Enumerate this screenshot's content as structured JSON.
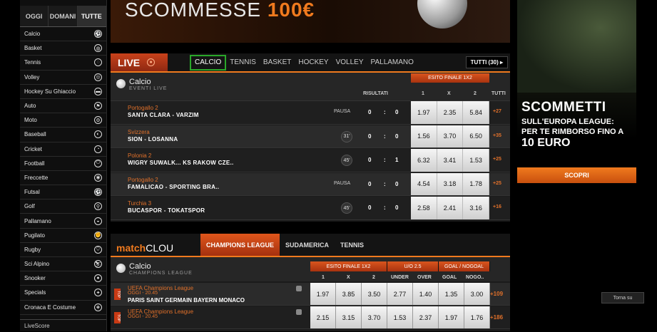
{
  "sidebar": {
    "tabs": [
      {
        "label": "OGGI"
      },
      {
        "label": "DOMANI"
      },
      {
        "label": "TUTTE"
      }
    ],
    "items": [
      {
        "label": "Calcio",
        "icon": "soccer-icon",
        "glyph": "⚽"
      },
      {
        "label": "Basket",
        "icon": "basketball-icon",
        "glyph": "◍"
      },
      {
        "label": "Tennis",
        "icon": "tennis-icon",
        "glyph": "◌"
      },
      {
        "label": "Volley",
        "icon": "volleyball-icon",
        "glyph": "◎"
      },
      {
        "label": "Hockey Su Ghiaccio",
        "icon": "hockey-icon",
        "glyph": "▬"
      },
      {
        "label": "Auto",
        "icon": "auto-icon",
        "glyph": "⚑"
      },
      {
        "label": "Moto",
        "icon": "moto-icon",
        "glyph": "⚙"
      },
      {
        "label": "Baseball",
        "icon": "baseball-icon",
        "glyph": "◐"
      },
      {
        "label": "Cricket",
        "icon": "cricket-icon",
        "glyph": "◔"
      },
      {
        "label": "Football",
        "icon": "football-icon",
        "glyph": "⬭"
      },
      {
        "label": "Freccette",
        "icon": "darts-icon",
        "glyph": "◉"
      },
      {
        "label": "Futsal",
        "icon": "futsal-icon",
        "glyph": "⚽"
      },
      {
        "label": "Golf",
        "icon": "golf-icon",
        "glyph": "⚲"
      },
      {
        "label": "Pallamano",
        "icon": "handball-icon",
        "glyph": "◒"
      },
      {
        "label": "Pugilato",
        "icon": "boxing-icon",
        "glyph": "✊"
      },
      {
        "label": "Rugby",
        "icon": "rugby-icon",
        "glyph": "⬯"
      },
      {
        "label": "Sci Alpino",
        "icon": "ski-icon",
        "glyph": "⛷"
      },
      {
        "label": "Snooker",
        "icon": "snooker-icon",
        "glyph": "●"
      },
      {
        "label": "Specials",
        "icon": "specials-icon",
        "glyph": "✦"
      },
      {
        "label": "Cronaca E Costume",
        "icon": "news-icon",
        "glyph": "◈"
      }
    ],
    "livescore_label": "LiveScore"
  },
  "top_banner": {
    "text": "SCOMMESSE",
    "amount": "100€"
  },
  "live": {
    "label": "LIVE",
    "tabs": [
      "CALCIO",
      "TENNIS",
      "BASKET",
      "HOCKEY",
      "VOLLEY",
      "PALLAMANO"
    ],
    "tutti_button": "TUTTI (30)",
    "sport_title": "Calcio",
    "sport_subtitle": "EVENTI LIVE",
    "col_risultati": "RISULTATI",
    "col_esito": "ESITO FINALE 1X2",
    "col_1": "1",
    "col_x": "X",
    "col_2": "2",
    "col_tutti": "TUTTI",
    "rows": [
      {
        "league": "Portogallo 2",
        "match": "SANTA CLARA - VARZIM",
        "status": "PAUSA",
        "minute": "",
        "home": "0",
        "sep": ":",
        "away": "0",
        "o1": "1.97",
        "ox": "2.35",
        "o2": "5.84",
        "more": "+27"
      },
      {
        "league": "Svizzera",
        "match": "SION - LOSANNA",
        "status": "",
        "minute": "31'",
        "home": "0",
        "sep": ":",
        "away": "0",
        "o1": "1.56",
        "ox": "3.70",
        "o2": "6.50",
        "more": "+35"
      },
      {
        "league": "Polonia 2",
        "match": "WIGRY SUWALK... KS RAKOW CZE..",
        "status": "",
        "minute": "45'",
        "home": "0",
        "sep": ":",
        "away": "1",
        "o1": "6.32",
        "ox": "3.41",
        "o2": "1.53",
        "more": "+25"
      },
      {
        "league": "Portogallo 2",
        "match": "FAMALICAO - SPORTING BRA..",
        "status": "PAUSA",
        "minute": "",
        "home": "0",
        "sep": ":",
        "away": "0",
        "o1": "4.54",
        "ox": "3.18",
        "o2": "1.78",
        "more": "+25"
      },
      {
        "league": "Turchia 3",
        "match": "BUCASPOR - TOKATSPOR",
        "status": "",
        "minute": "45'",
        "home": "0",
        "sep": ":",
        "away": "0",
        "o1": "2.58",
        "ox": "2.41",
        "o2": "3.16",
        "more": "+16"
      }
    ]
  },
  "matchclou": {
    "logo_a": "match",
    "logo_b": "CLOU",
    "tabs": [
      "CHAMPIONS LEAGUE",
      "SUDAMERICA",
      "TENNIS"
    ],
    "sport_title": "Calcio",
    "sport_subtitle": "CHAMPIONS LEAGUE",
    "h_esito": "ESITO FINALE 1X2",
    "h_uo": "U/O 2.5",
    "h_gol": "GOAL / NOGOAL",
    "cols": [
      "1",
      "X",
      "2",
      "UNDER",
      "OVER",
      "GOAL",
      "NOGO.."
    ],
    "rows": [
      {
        "tag": "TOP",
        "league": "UEFA Champions League",
        "date": "OGGI - 20.45",
        "match": "PARIS SAINT GERMAIN  BAYERN MONACO",
        "odds": [
          "1.97",
          "3.85",
          "3.50",
          "2.77",
          "1.40",
          "1.35",
          "3.00"
        ],
        "more": "+109"
      },
      {
        "tag": "TOP",
        "league": "UEFA Champions League",
        "date": "OGGI - 20.45",
        "match": "",
        "odds": [
          "2.15",
          "3.15",
          "3.70",
          "1.53",
          "2.37",
          "1.97",
          "1.76"
        ],
        "more": "+186"
      }
    ]
  },
  "right_ad": {
    "title": "SCOMMETTI",
    "line1": "SULL'EUROPA LEAGUE:",
    "line2": "PER TE RIMBORSO FINO A",
    "amount": "10 EURO",
    "button": "SCOPRI"
  },
  "torna_su": "Torna su"
}
